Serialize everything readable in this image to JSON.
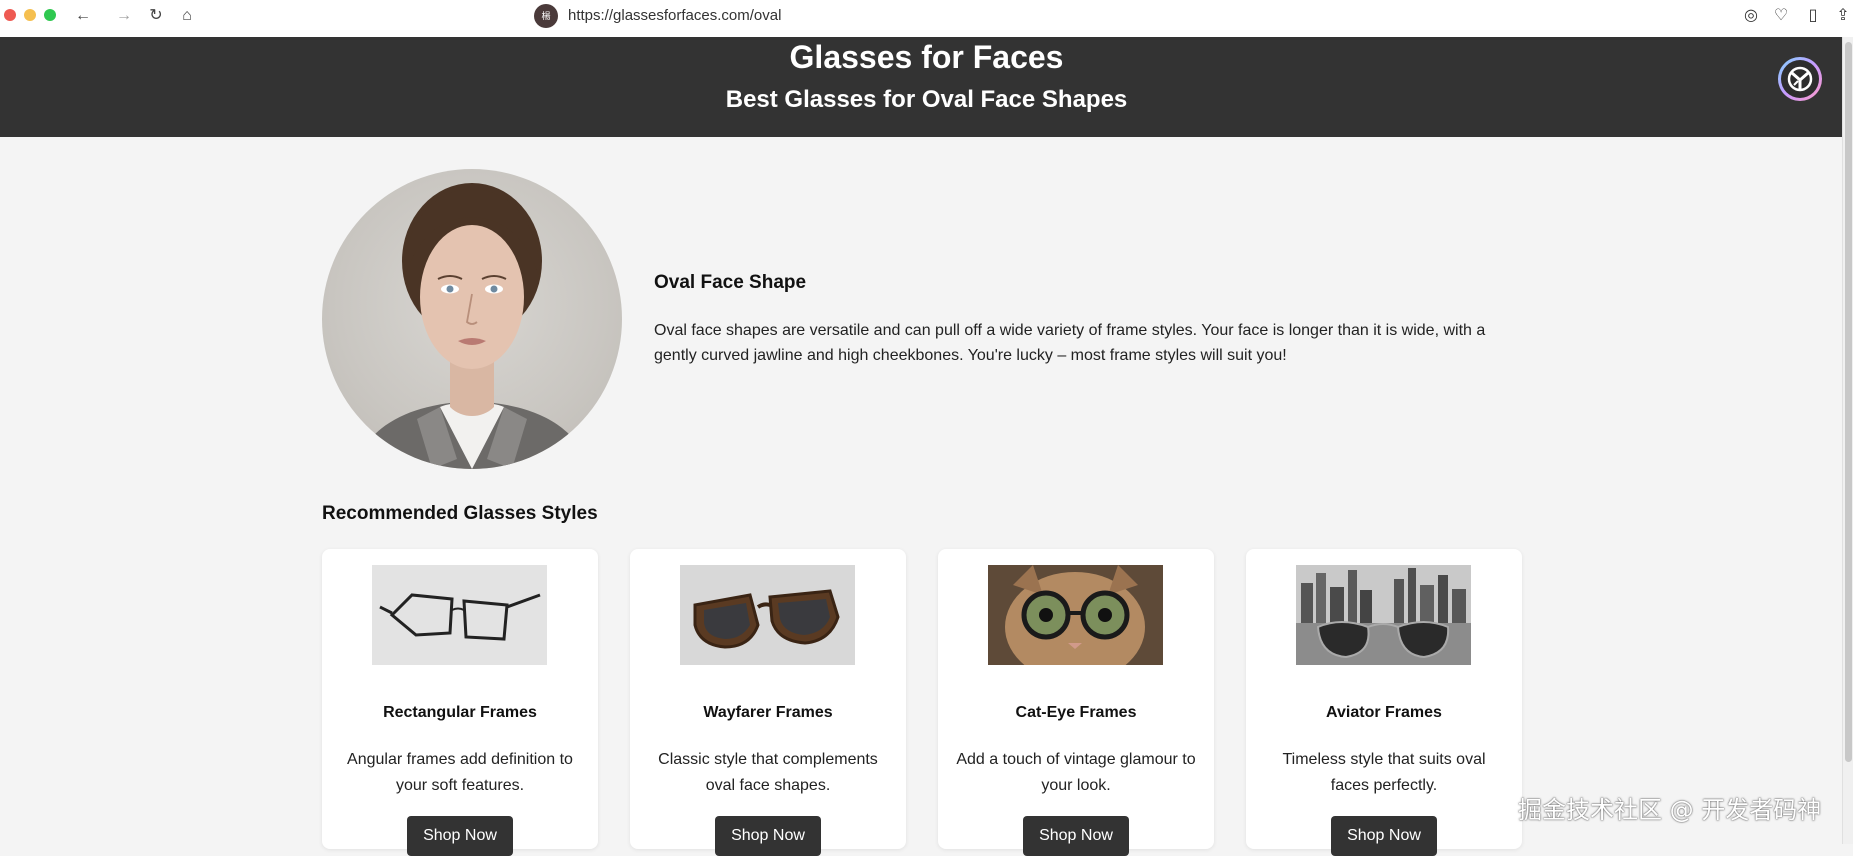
{
  "browser": {
    "url": "https://glassesforfaces.com/oval",
    "site_icon_glyph": "楊",
    "back_glyph": "←",
    "forward_glyph": "→",
    "reload_glyph": "↻",
    "home_glyph": "⌂",
    "right_icons": [
      "◎",
      "♡",
      "▯",
      "⇪"
    ]
  },
  "header": {
    "title": "Glasses for Faces",
    "subtitle": "Best Glasses for Oval Face Shapes"
  },
  "intro": {
    "heading": "Oval Face Shape",
    "text": "Oval face shapes are versatile and can pull off a wide variety of frame styles. Your face is longer than it is wide, with a gently curved jawline and high cheekbones. You're lucky – most frame styles will suit you!"
  },
  "recommendations": {
    "title": "Recommended Glasses Styles",
    "cards": [
      {
        "title": "Rectangular Frames",
        "desc": "Angular frames add definition to your soft features.",
        "button": "Shop Now"
      },
      {
        "title": "Wayfarer Frames",
        "desc": "Classic style that complements oval face shapes.",
        "button": "Shop Now"
      },
      {
        "title": "Cat-Eye Frames",
        "desc": "Add a touch of vintage glamour to your look.",
        "button": "Shop Now"
      },
      {
        "title": "Aviator Frames",
        "desc": "Timeless style that suits oval faces perfectly.",
        "button": "Shop Now"
      }
    ]
  },
  "watermark": "掘金技术社区 @ 开发者码神",
  "colors": {
    "header_bg": "#333333",
    "page_bg": "#f4f4f4",
    "button_bg": "#333333"
  }
}
